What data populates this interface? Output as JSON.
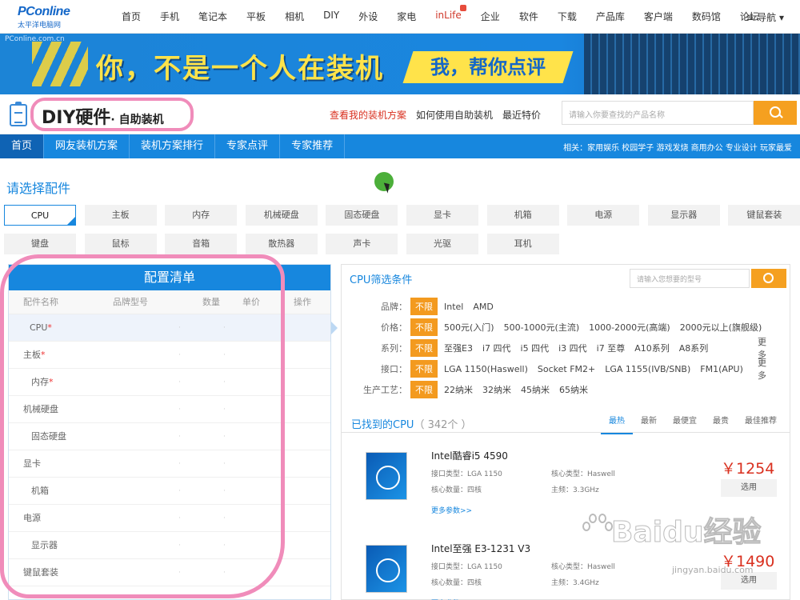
{
  "logo": {
    "brand": "PConline",
    "sub": "太平洋电脑网"
  },
  "topnav": [
    "首页",
    "手机",
    "笔记本",
    "平板",
    "相机",
    "DIY",
    "外设",
    "家电",
    "inLife",
    "企业",
    "软件",
    "下载",
    "产品库",
    "客户端",
    "数码馆",
    "论坛"
  ],
  "guide": "≡ 导航 ▾",
  "banner": {
    "tag": "PConline.com.cn",
    "slogan1": "你，不是一个人在装机",
    "slogan2": "我，帮你点评"
  },
  "title": {
    "main": "DIY硬件",
    "sub": "· 自助装机"
  },
  "header_links": {
    "red": "查看我的装机方案",
    "link1": "如何使用自助装机",
    "link2": "最近特价"
  },
  "search_top_placeholder": "请输入你要查找的产品名称",
  "bluenav": {
    "tabs": [
      "首页",
      "网友装机方案",
      "装机方案排行",
      "专家点评",
      "专家推荐"
    ],
    "hot": "相关：家用娱乐 校园学子 游戏发烧 商用办公 专业设计 玩家最爱"
  },
  "select_title": "请选择配件",
  "parts_row1": [
    "CPU",
    "主板",
    "内存",
    "机械硬盘",
    "固态硬盘",
    "显卡",
    "机箱",
    "电源",
    "显示器",
    "键鼠套装"
  ],
  "parts_row2": [
    "键盘",
    "鼠标",
    "音箱",
    "散热器",
    "声卡",
    "光驱",
    "耳机"
  ],
  "config": {
    "title": "配置清单",
    "cols": [
      "配件名称",
      "品牌型号",
      "数量",
      "单价",
      "操作"
    ],
    "rows": [
      {
        "name": "CPU",
        "req": "*"
      },
      {
        "name": "主板",
        "req": "*"
      },
      {
        "name": "内存",
        "req": "*"
      },
      {
        "name": "机械硬盘",
        "req": ""
      },
      {
        "name": "固态硬盘",
        "req": ""
      },
      {
        "name": "显卡",
        "req": ""
      },
      {
        "name": "机箱",
        "req": ""
      },
      {
        "name": "电源",
        "req": ""
      },
      {
        "name": "显示器",
        "req": ""
      },
      {
        "name": "键鼠套装",
        "req": ""
      }
    ]
  },
  "filter": {
    "title": "CPU筛选条件",
    "search_placeholder": "请输入您想要的型号",
    "all": "不限",
    "more": "更多",
    "rows": [
      {
        "label": "品牌：",
        "opts": [
          "Intel",
          "AMD"
        ],
        "more": false
      },
      {
        "label": "价格：",
        "opts": [
          "500元(入门)",
          "500-1000元(主流)",
          "1000-2000元(高端)",
          "2000元以上(旗舰级)"
        ],
        "more": false
      },
      {
        "label": "系列：",
        "opts": [
          "至强E3",
          "i7 四代",
          "i5 四代",
          "i3 四代",
          "i7 至尊",
          "A10系列",
          "A8系列"
        ],
        "more": true
      },
      {
        "label": "接口：",
        "opts": [
          "LGA 1150(Haswell)",
          "Socket FM2+",
          "LGA 1155(IVB/SNB)",
          "FM1(APU)"
        ],
        "more": true
      },
      {
        "label": "生产工艺：",
        "opts": [
          "22纳米",
          "32纳米",
          "45纳米",
          "65纳米"
        ],
        "more": false
      }
    ]
  },
  "found": {
    "title": "已找到的CPU",
    "count": "（ 342个 ）",
    "sorts": [
      "最热",
      "最新",
      "最便宜",
      "最贵",
      "最佳推荐"
    ]
  },
  "products": [
    {
      "name": "Intel酷睿i5 4590",
      "s1": "接口类型：LGA 1150",
      "s2": "核心类型：Haswell",
      "s3": "核心数量：四核",
      "s4": "主频：3.3GHz",
      "more": "更多参数>>",
      "price": "￥1254",
      "buy": "选用"
    },
    {
      "name": "Intel至强 E3-1231 V3",
      "s1": "接口类型：LGA 1150",
      "s2": "核心类型：Haswell",
      "s3": "核心数量：四核",
      "s4": "主频：3.4GHz",
      "more": "更多参数>>",
      "price": "￥1490",
      "buy": "选用"
    }
  ],
  "watermark": {
    "main": "Baidu经验",
    "sub": "jingyan.baidu.com"
  }
}
